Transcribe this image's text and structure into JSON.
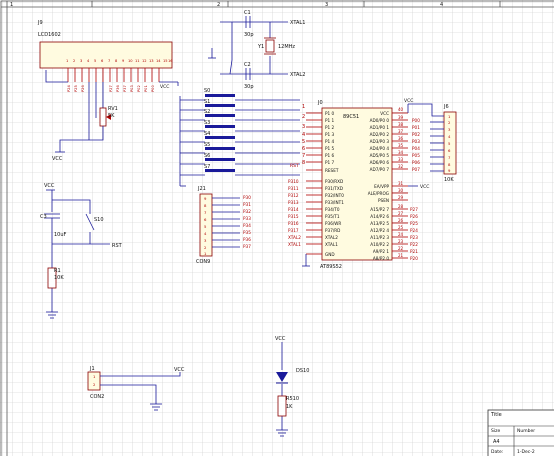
{
  "grid": {
    "color": "#c8c8c8",
    "background": "#ffffff"
  },
  "colors": {
    "wire": "#1a1a9a",
    "pin": "#b00000",
    "body": "#fffbe0",
    "outline": "#8b0000",
    "text": "#000000"
  },
  "border": {
    "zones": [
      "1",
      "2",
      "3",
      "4"
    ],
    "zone_left": [
      "1",
      "2",
      "3",
      "4"
    ]
  },
  "lcd": {
    "ref": "J9",
    "value": "LCD1602",
    "pins": [
      "1",
      "2",
      "3",
      "4",
      "5",
      "6",
      "7",
      "8",
      "9",
      "10",
      "11",
      "12",
      "13",
      "14",
      "15",
      "16"
    ],
    "nets": [
      "P24",
      "P25",
      "P26",
      "P27",
      "P36",
      "P37",
      "P03",
      "P02",
      "P01",
      "P00",
      "VCC"
    ],
    "vcc": "VCC"
  },
  "pot": {
    "ref": "RV1",
    "value": "5K",
    "vcc": "VCC"
  },
  "crystal": {
    "c1_ref": "C1",
    "c1_val": "30p",
    "c2_ref": "C2",
    "c2_val": "30p",
    "x_ref": "Y1",
    "x_val": "12MHz",
    "net1": "XTAL1",
    "net2": "XTAL2"
  },
  "switches": {
    "refs": [
      "S0",
      "S1",
      "S2",
      "S3",
      "S4",
      "S5",
      "S6",
      "S7"
    ],
    "pins": [
      "1",
      "2",
      "3",
      "4",
      "5",
      "6",
      "7",
      "8"
    ]
  },
  "mcu": {
    "ref": "J0",
    "name": "89C51",
    "part": "AT89S52",
    "left_labels": [
      "P1 0",
      "P1 1",
      "P1 2",
      "P1 3",
      "P1 4",
      "P1 5",
      "P1 6",
      "P1 7",
      "RESET",
      "P30/RXD",
      "P31/TXD",
      "P32/INT0",
      "P33/INT1",
      "P34/T0",
      "P35/T1",
      "P36/WR",
      "P37/RD",
      "XTAL2",
      "XTAL1",
      "GND"
    ],
    "left_pins": [
      "1",
      "2",
      "3",
      "4",
      "5",
      "6",
      "7",
      "8",
      "9",
      "10",
      "11",
      "12",
      "13",
      "14",
      "15",
      "16",
      "17",
      "18",
      "19",
      "20"
    ],
    "right_labels": [
      "VCC",
      "AD0/P0 0",
      "AD1/P0 1",
      "AD2/P0 2",
      "AD3/P0 3",
      "AD4/P0 4",
      "AD5/P0 5",
      "AD6/P0 6",
      "AD7/P0 7",
      "EA/VPP",
      "ALE/PROG",
      "PSEN",
      "A15/P2 7",
      "A14/P2 6",
      "A13/P2 5",
      "A12/P2 4",
      "A11/P2 3",
      "A10/P2 2",
      "A9/P2 1",
      "A8/P2 0"
    ],
    "right_pins": [
      "40",
      "39",
      "38",
      "37",
      "36",
      "35",
      "34",
      "33",
      "32",
      "31",
      "30",
      "29",
      "28",
      "27",
      "26",
      "25",
      "24",
      "23",
      "22",
      "21"
    ],
    "left_nets": [
      "P310",
      "P311",
      "P312",
      "P313",
      "P314",
      "P315",
      "P316",
      "P317",
      "XTAL2",
      "XTAL1"
    ],
    "right_nets": [
      "P00",
      "P01",
      "P02",
      "P03",
      "P04",
      "P05",
      "P06",
      "P07"
    ],
    "p2_nets": [
      "P27",
      "P26",
      "P25",
      "P24",
      "P23",
      "P22",
      "P21",
      "P20"
    ],
    "rst_label": "RST",
    "vcc": "VCC",
    "vcc2": "VCC"
  },
  "j6": {
    "ref": "J6",
    "value": "10K",
    "pins": [
      "1",
      "2",
      "3",
      "4",
      "5",
      "6",
      "7",
      "8",
      "9"
    ],
    "vcc": "VCC"
  },
  "j21": {
    "ref": "J21",
    "value": "CON9",
    "pins": [
      "9",
      "8",
      "7",
      "6",
      "5",
      "4",
      "3",
      "2",
      "1"
    ],
    "nets": [
      "P30",
      "P31",
      "P32",
      "P33",
      "P34",
      "P35",
      "P36",
      "P37"
    ]
  },
  "reset": {
    "vcc": "VCC",
    "c_ref": "C3",
    "c_val": "10uF",
    "s_ref": "S10",
    "rst": "RST",
    "r_ref": "R1",
    "r_val": "10K"
  },
  "power": {
    "ref": "J1",
    "value": "CON2",
    "vcc": "VCC",
    "pins": [
      "1",
      "2"
    ]
  },
  "led": {
    "vcc": "VCC",
    "d_ref": "DS10",
    "r_ref": "R510",
    "r_val": "1K"
  },
  "titleblock": {
    "title": "Title",
    "size_label": "Size",
    "size": "A4",
    "number_label": "Number",
    "date_label": "Date:",
    "date": "1-Dec-2"
  }
}
